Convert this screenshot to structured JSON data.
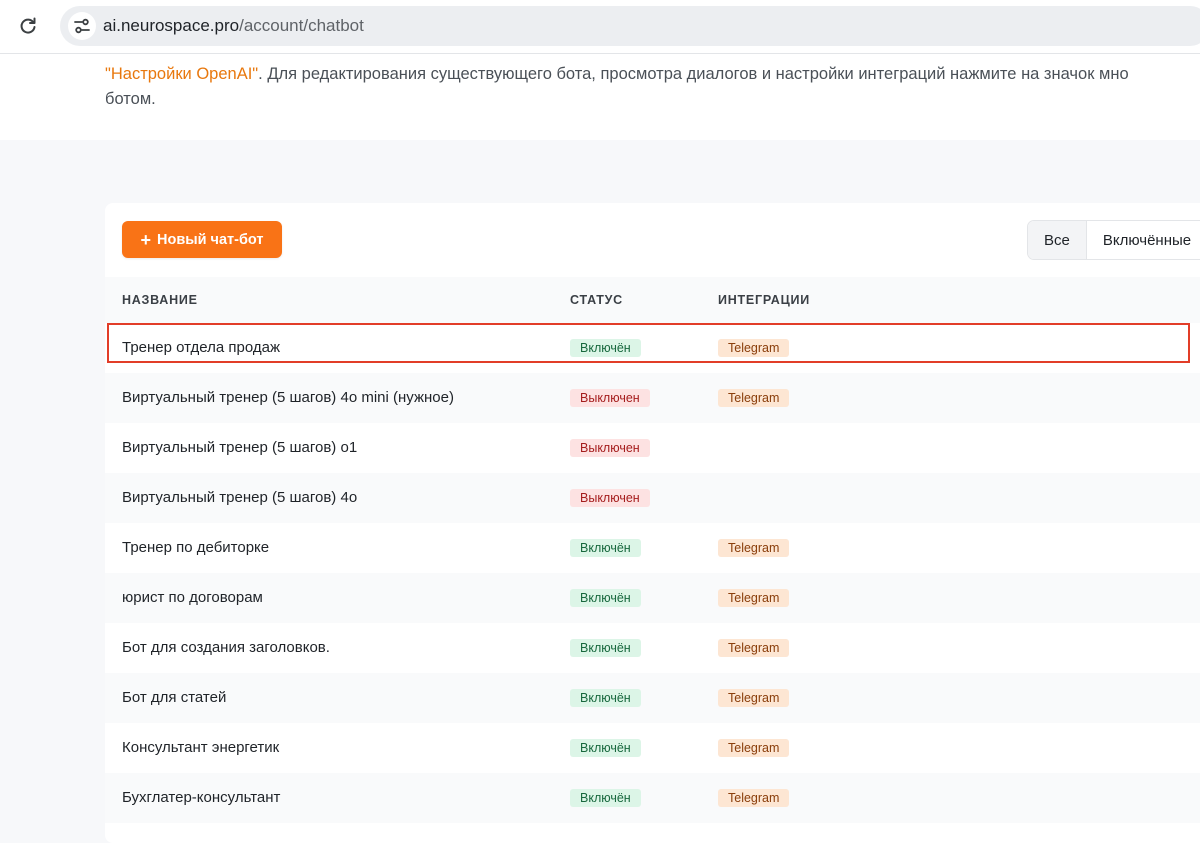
{
  "browser": {
    "url_host": "ai.neurospace.pro",
    "url_path": "/account/chatbot",
    "reload_icon": "reload-icon",
    "site_info_icon": "site-settings-icon"
  },
  "intro": {
    "line1_link": "\"Настройки OpenAI\"",
    "line1_rest": ". Для редактирования существующего бота, просмотра диалогов и настройки интеграций нажмите на значок мно",
    "line2": "ботом."
  },
  "toolbar": {
    "new_bot_icon": "+",
    "new_bot_label": "Новый чат-бот",
    "filters": [
      "Все",
      "Включённые"
    ]
  },
  "table": {
    "headers": {
      "name": "НАЗВАНИЕ",
      "status": "СТАТУС",
      "integrations": "ИНТЕГРАЦИИ"
    },
    "rows": [
      {
        "name": "Тренер отдела продаж",
        "status": "Включён",
        "status_state": "on",
        "integration": "Telegram"
      },
      {
        "name": "Виртуальный тренер (5 шагов) 4o mini (нужное)",
        "status": "Выключен",
        "status_state": "off",
        "integration": "Telegram"
      },
      {
        "name": "Виртуальный тренер (5 шагов) o1",
        "status": "Выключен",
        "status_state": "off",
        "integration": ""
      },
      {
        "name": "Виртуальный тренер (5 шагов) 4o",
        "status": "Выключен",
        "status_state": "off",
        "integration": ""
      },
      {
        "name": "Тренер по дебиторке",
        "status": "Включён",
        "status_state": "on",
        "integration": "Telegram"
      },
      {
        "name": "юрист по договорам",
        "status": "Включён",
        "status_state": "on",
        "integration": "Telegram"
      },
      {
        "name": "Бот для создания заголовков.",
        "status": "Включён",
        "status_state": "on",
        "integration": "Telegram"
      },
      {
        "name": "Бот для статей",
        "status": "Включён",
        "status_state": "on",
        "integration": "Telegram"
      },
      {
        "name": "Консультант энергетик",
        "status": "Включён",
        "status_state": "on",
        "integration": "Telegram"
      },
      {
        "name": "Бухглатер-консультант",
        "status": "Включён",
        "status_state": "on",
        "integration": "Telegram"
      }
    ]
  },
  "colors": {
    "accent": "#f97316",
    "link": "#e8780e",
    "status_on_bg": "#dcf5e7",
    "status_off_bg": "#fde2e2",
    "integration_bg": "#fde6d3",
    "highlight": "#e23d28"
  }
}
